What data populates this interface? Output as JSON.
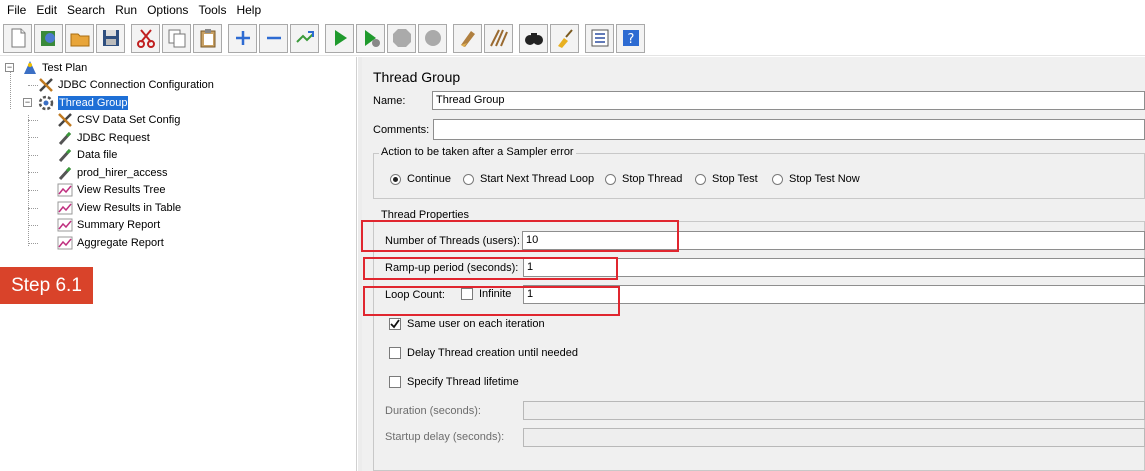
{
  "menu": [
    "File",
    "Edit",
    "Search",
    "Run",
    "Options",
    "Tools",
    "Help"
  ],
  "toolbar": {
    "icons": [
      "new-icon",
      "templates-icon",
      "open-icon",
      "save-icon",
      "cut-icon",
      "copy-icon",
      "paste-icon",
      "expand-icon",
      "collapse-icon",
      "toggle-icon",
      "start-icon",
      "start-no-pauses-icon",
      "stop-icon",
      "shutdown-icon",
      "clear-icon",
      "clear-all-icon",
      "search-icon",
      "reset-search-icon",
      "function-helper-icon",
      "help-icon"
    ]
  },
  "tree": {
    "nodes": [
      {
        "label": "Test Plan",
        "icon": "test-plan-icon"
      },
      {
        "label": "JDBC Connection Configuration",
        "icon": "config-element-icon"
      },
      {
        "label": "Thread Group",
        "icon": "thread-group-icon",
        "selected": true
      },
      {
        "label": "CSV Data Set Config",
        "icon": "config-element-icon"
      },
      {
        "label": "JDBC Request",
        "icon": "sampler-icon"
      },
      {
        "label": "Data file",
        "icon": "sampler-icon"
      },
      {
        "label": "prod_hirer_access",
        "icon": "sampler-icon"
      },
      {
        "label": "View Results Tree",
        "icon": "listener-icon"
      },
      {
        "label": "View Results in Table",
        "icon": "listener-icon"
      },
      {
        "label": "Summary Report",
        "icon": "listener-icon"
      },
      {
        "label": "Aggregate Report",
        "icon": "listener-icon"
      }
    ]
  },
  "step_badge": "Step 6.1",
  "panel": {
    "title": "Thread Group",
    "name_label": "Name:",
    "name_value": "Thread Group",
    "comments_label": "Comments:",
    "comments_value": "",
    "error_group_title": "Action to be taken after a Sampler error",
    "error_actions": [
      {
        "label": "Continue",
        "selected": true
      },
      {
        "label": "Start Next Thread Loop",
        "selected": false
      },
      {
        "label": "Stop Thread",
        "selected": false
      },
      {
        "label": "Stop Test",
        "selected": false
      },
      {
        "label": "Stop Test Now",
        "selected": false
      }
    ],
    "thread_props_title": "Thread Properties",
    "threads_label": "Number of Threads (users):",
    "threads_value": "10",
    "rampup_label": "Ramp-up period (seconds):",
    "rampup_value": "1",
    "loop_label": "Loop Count:",
    "infinite_label": "Infinite",
    "infinite_checked": false,
    "loop_value": "1",
    "same_user_label": "Same user on each iteration",
    "same_user_checked": true,
    "delay_label": "Delay Thread creation until needed",
    "delay_checked": false,
    "lifetime_label": "Specify Thread lifetime",
    "lifetime_checked": false,
    "duration_label": "Duration (seconds):",
    "duration_value": "",
    "startup_label": "Startup delay (seconds):",
    "startup_value": ""
  },
  "colors": {
    "highlight": "#e0262f",
    "badge": "#d9432a",
    "selection": "#1e6fd6"
  }
}
